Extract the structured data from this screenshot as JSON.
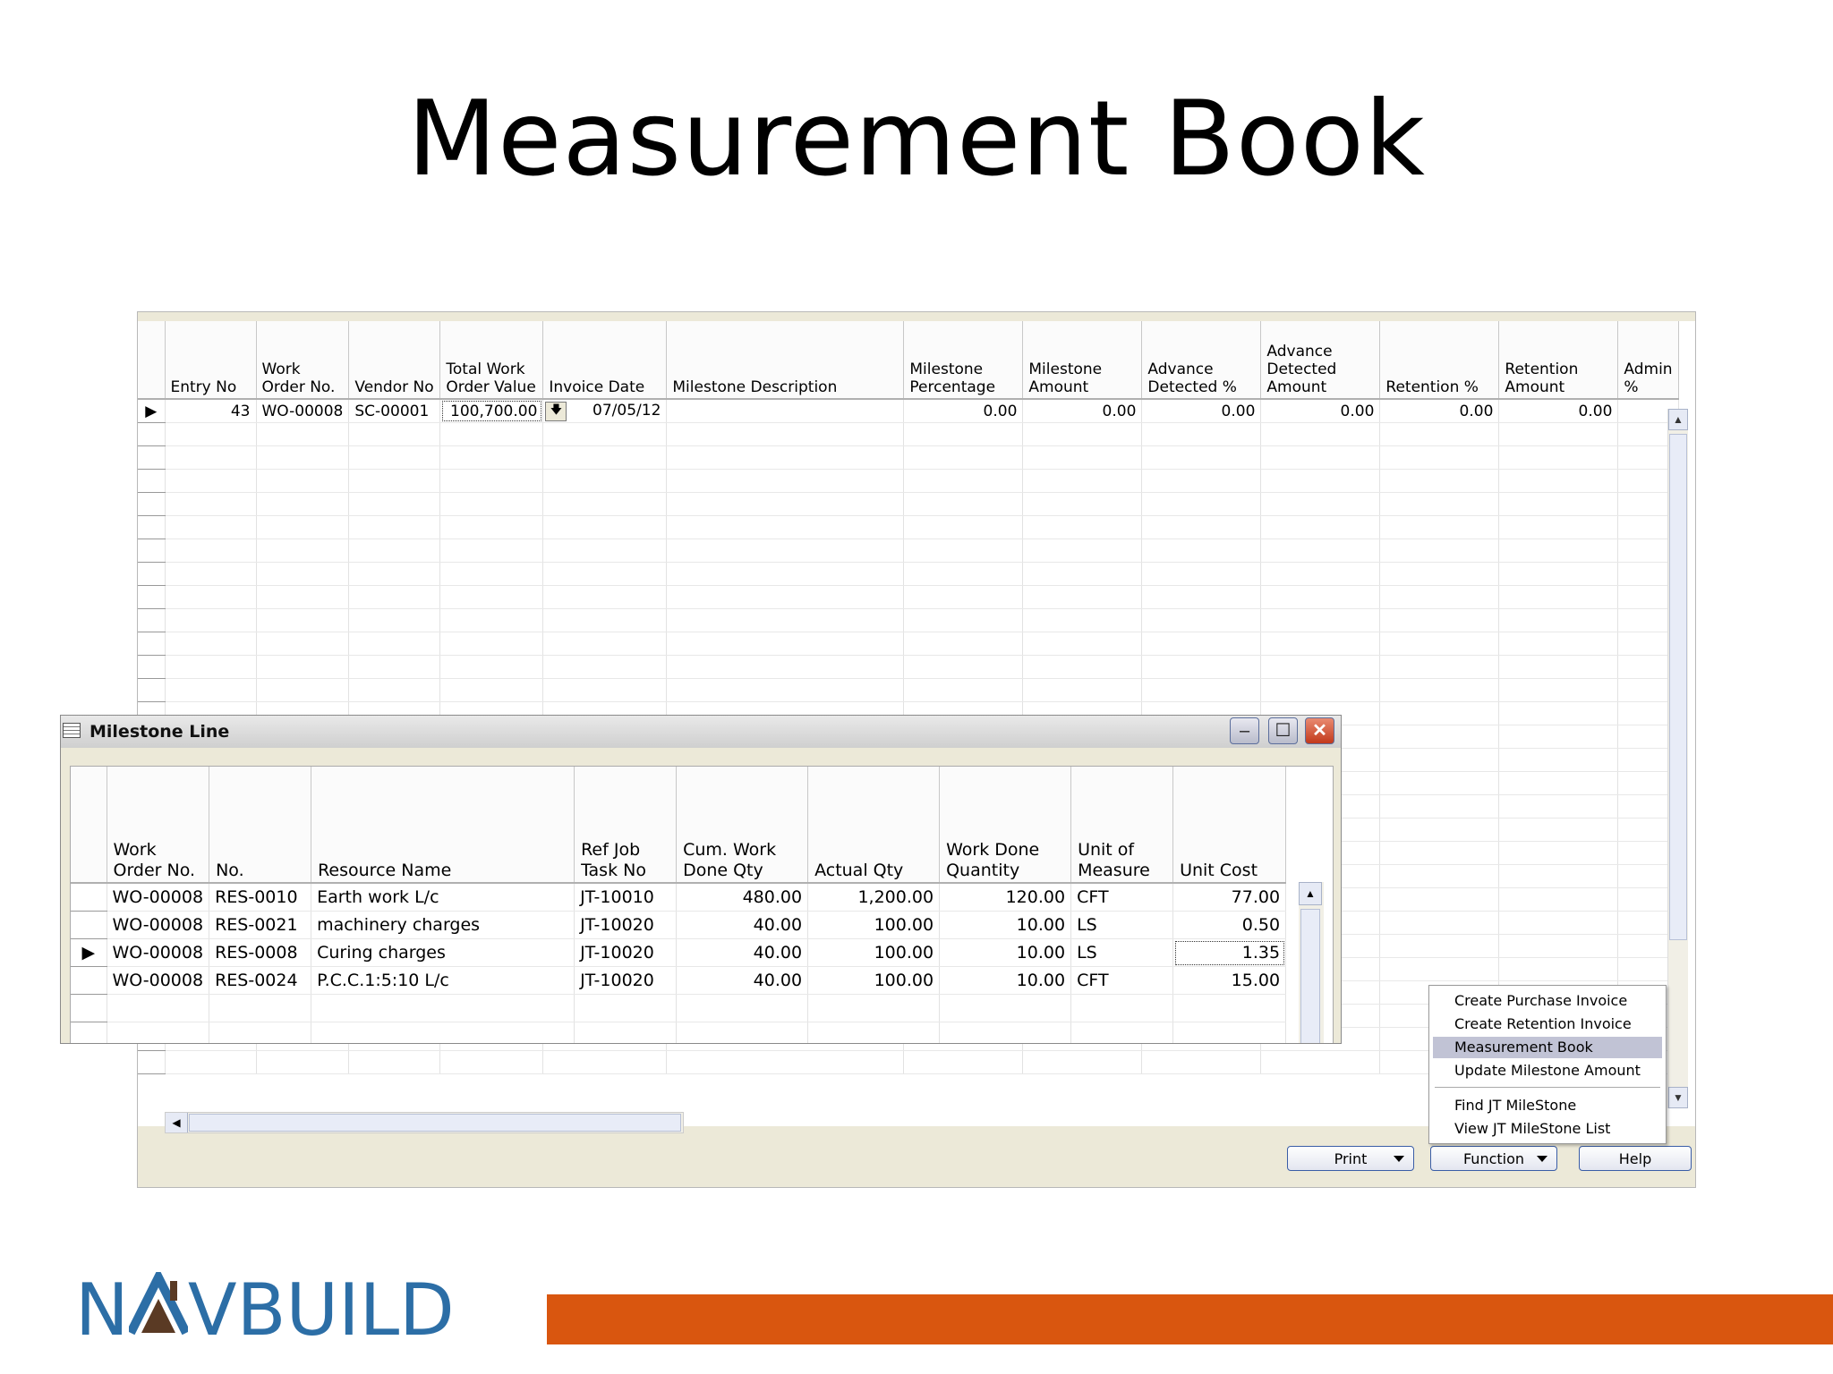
{
  "slide": {
    "title": "Measurement Book",
    "brand": {
      "prefix": "N",
      "suffix": "VBUILD",
      "logo_text": "NAVBUILD",
      "brand_color": "#2c6ea6",
      "bar_color": "#d9560f"
    }
  },
  "main_form": {
    "columns": [
      "Entry No",
      "Work Order No.",
      "Vendor No",
      "Total Work Order Value",
      "Invoice Date",
      "Milestone Description",
      "Milestone Percentage",
      "Milestone Amount",
      "Advance Detected %",
      "Advance Detected Amount",
      "Retention %",
      "Retention Amount",
      "Admin %"
    ],
    "row": {
      "entry_no": "43",
      "work_order_no": "WO-00008",
      "vendor_no": "SC-00001",
      "total_work_order_value": "100,700.00",
      "invoice_date": "07/05/12",
      "milestone_description": "",
      "milestone_percentage": "0.00",
      "milestone_amount": "0.00",
      "advance_detected_pct": "0.00",
      "advance_detected_amount": "0.00",
      "retention_pct": "0.00",
      "retention_amount": "0.00",
      "admin_pct": ""
    },
    "buttons": {
      "print": "Print",
      "function": "Function",
      "help": "Help"
    },
    "function_menu": [
      {
        "label": "Create Purchase Invoice",
        "highlighted": false
      },
      {
        "label": "Create Retention Invoice",
        "highlighted": false
      },
      {
        "label": "Measurement Book",
        "highlighted": true
      },
      {
        "label": "Update Milestone Amount",
        "highlighted": false
      },
      {
        "label": "Find JT MileStone",
        "highlighted": false
      },
      {
        "label": "View JT MileStone List",
        "highlighted": false
      }
    ]
  },
  "milestone_line": {
    "window_title": "Milestone Line",
    "columns": [
      "Work Order No.",
      "No.",
      "Resource Name",
      "Ref Job Task No",
      "Cum. Work Done Qty",
      "Actual Qty",
      "Work Done Quantity",
      "Unit of Measure",
      "Unit Cost"
    ],
    "rows": [
      {
        "work_order_no": "WO-00008",
        "no": "RES-0010",
        "resource_name": "Earth work L/c",
        "ref_job_task_no": "JT-10010",
        "cum_work_done_qty": "480.00",
        "actual_qty": "1,200.00",
        "work_done_quantity": "120.00",
        "unit_of_measure": "CFT",
        "unit_cost": "77.00"
      },
      {
        "work_order_no": "WO-00008",
        "no": "RES-0021",
        "resource_name": "machinery charges",
        "ref_job_task_no": "JT-10020",
        "cum_work_done_qty": "40.00",
        "actual_qty": "100.00",
        "work_done_quantity": "10.00",
        "unit_of_measure": "LS",
        "unit_cost": "0.50"
      },
      {
        "work_order_no": "WO-00008",
        "no": "RES-0008",
        "resource_name": "Curing charges",
        "ref_job_task_no": "JT-10020",
        "cum_work_done_qty": "40.00",
        "actual_qty": "100.00",
        "work_done_quantity": "10.00",
        "unit_of_measure": "LS",
        "unit_cost": "1.35"
      },
      {
        "work_order_no": "WO-00008",
        "no": "RES-0024",
        "resource_name": "P.C.C.1:5:10 L/c",
        "ref_job_task_no": "JT-10020",
        "cum_work_done_qty": "40.00",
        "actual_qty": "100.00",
        "work_done_quantity": "10.00",
        "unit_of_measure": "CFT",
        "unit_cost": "15.00"
      }
    ]
  },
  "icons": {
    "row_pointer": "row-pointer-icon",
    "lookup": "lookup-arrow-icon",
    "scroll_up": "scroll-up-icon",
    "scroll_down": "scroll-down-icon",
    "scroll_left": "scroll-left-icon"
  }
}
